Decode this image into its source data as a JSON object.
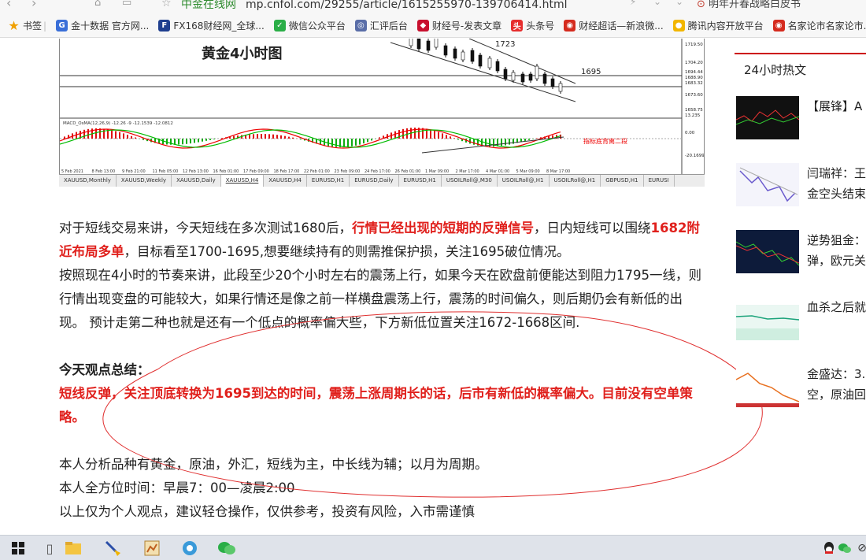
{
  "browser": {
    "url_site": "中金在线网",
    "url": "mp.cnfol.com/29255/article/1615255970-139706414.html",
    "search_text": "明年开春战略白皮书"
  },
  "bookmarks": [
    {
      "label": "书签",
      "icon": "star-icon",
      "color": "#f0a000"
    },
    {
      "label": "金十数据 官方网...",
      "icon": "jin10-icon",
      "color": "#3a6fd8"
    },
    {
      "label": "FX168财经网_全球...",
      "icon": "fx168-icon",
      "color": "#1f3f8f"
    },
    {
      "label": "微信公众平台",
      "icon": "wechat-icon",
      "color": "#2aae47"
    },
    {
      "label": "汇评后台",
      "icon": "huiping-icon",
      "color": "#5a6ea8"
    },
    {
      "label": "财经号-发表文章",
      "icon": "caijinghao-icon",
      "color": "#c8102e"
    },
    {
      "label": "头条号",
      "icon": "toutiao-icon",
      "color": "#e62e2e"
    },
    {
      "label": "财经超话—新浪微...",
      "icon": "weibo-icon",
      "color": "#d52b1e"
    },
    {
      "label": "腾讯内容开放平台",
      "icon": "tencent-icon",
      "color": "#f2b600"
    },
    {
      "label": "名家论市名家论市...",
      "icon": "weibo-icon",
      "color": "#d52b1e"
    }
  ],
  "chart": {
    "title": "黄金4小时图",
    "label_1723": "1723",
    "label_1695": "1695",
    "price_labels": [
      "1719.50",
      "1704.20",
      "1694.44",
      "1688.90",
      "1683.32",
      "1673.60",
      "1658.75",
      "13.235",
      "0.00",
      "-20.1699"
    ],
    "macd_label": "MACD_OsMA(12,26,9) -12.26 -9 -12.1539 -12.0812",
    "annotation": "指标底背离二段",
    "time_labels": [
      "5 Feb 2021",
      "8 Feb 13:00",
      "9 Feb 21:00",
      "11 Feb 05:00",
      "12 Feb 13:00",
      "16 Feb 01:00",
      "17 Feb 09:00",
      "18 Feb 17:00",
      "22 Feb 01:00",
      "23 Feb 09:00",
      "24 Feb 17:00",
      "26 Feb 01:00",
      "1 Mar 09:00",
      "2 Mar 17:00",
      "4 Mar 01:00",
      "5 Mar 09:00",
      "8 Mar 17:00"
    ],
    "tabs": [
      "XAUUSD,Monthly",
      "XAUUSD,Weekly",
      "XAUUSD,Daily",
      "XAUUSD,H4",
      "XAUUSD,H4",
      "EURUSD,H1",
      "EURUSD,Daily",
      "EURUSD,H1",
      "USOILRoll@,M30",
      "USOILRoll@,H1",
      "USOILRoll@,H1",
      "GBPUSD,H1",
      "EURUSI"
    ],
    "active_tab": 3
  },
  "article": {
    "p1_a": "对于短线交易来讲，今天短线在多次测试1680后，",
    "p1_hl1": "行情已经出现的短期的反弹信号",
    "p1_b": "，日内短线可以围绕",
    "p1_hl2": "1682附近布局多单",
    "p1_c": "，目标看至1700-1695,想要继续持有的则需推保护损，关注1695破位情况。",
    "p2": "按照现在4小时的节奏来讲，此段至少20个小时左右的震荡上行，如果今天在欧盘前便能达到阻力1795一线，则行情出现变盘的可能较大，如果行情还是像之前一样横盘震荡上行，震荡的时间偏久，则后期仍会有新低的出现。 预计走第二种也就是还有一个低点的概率偏大些，下方新低位置关注1672-1668区间.",
    "summary_title": "今天观点总结：",
    "summary": "短线反弹，关注顶底转换为1695到达的时间，震荡上涨周期长的话，后市有新低的概率偏大。目前没有空单策略。",
    "p3": "本人分析品种有黄金，原油，外汇，短线为主，中长线为辅；以月为周期。",
    "p4": "本人全方位时间：早晨7：00—凌晨2:00",
    "p5": "以上仅为个人观点，建议轻仓操作，仅供参考，投资有风险，入市需谨慎"
  },
  "sidebar": {
    "title": "24小时热文",
    "items": [
      {
        "line1": "【展锋】A",
        "line2": ""
      },
      {
        "line1": "闫瑞祥：王",
        "line2": "金空头结束"
      },
      {
        "line1": "逆势狙金：",
        "line2": "弹，欧元关"
      },
      {
        "line1": "血杀之后就",
        "line2": ""
      },
      {
        "line1": "金盛达：3.",
        "line2": "空，原油回"
      }
    ]
  },
  "colors": {
    "highlight": "#e0201c",
    "accent_rule": "#cc0000",
    "ellipse": "#e03030"
  }
}
